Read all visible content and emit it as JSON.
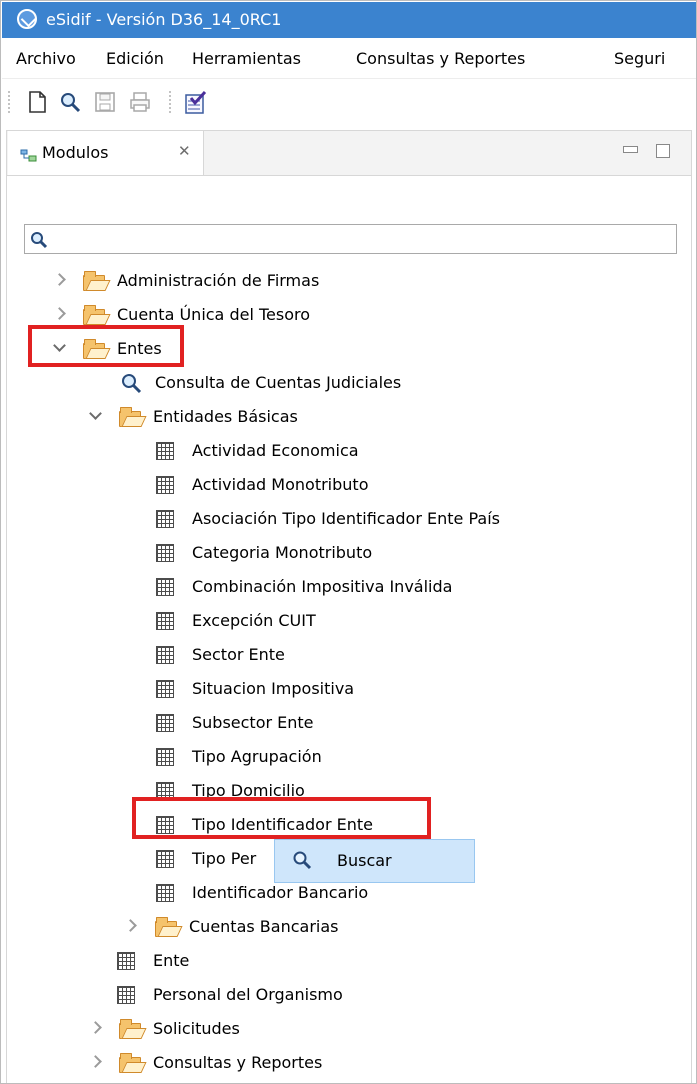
{
  "window": {
    "title": "eSidif - Versión D36_14_0RC1"
  },
  "menubar": {
    "items": [
      "Archivo",
      "Edición",
      "Herramientas",
      "Consultas y Reportes",
      "Seguri"
    ]
  },
  "toolbar": {
    "icons": [
      "new-document-icon",
      "search-icon",
      "save-icon",
      "print-icon",
      "checklist-icon"
    ]
  },
  "panel": {
    "tab_label": "Modulos",
    "close_symbol": "✕",
    "search": {
      "value": "",
      "placeholder": ""
    }
  },
  "tree": {
    "items": [
      "Administración de Firmas",
      "Cuenta Única del Tesoro",
      "Entes",
      "Consulta de Cuentas Judiciales",
      "Entidades Básicas",
      "Actividad Economica",
      "Actividad Monotributo",
      "Asociación Tipo Identificador Ente País",
      "Categoria Monotributo",
      "Combinación Impositiva Inválida",
      "Excepción CUIT",
      "Sector Ente",
      "Situacion Impositiva",
      "Subsector Ente",
      "Tipo Agrupación",
      "Tipo Domicilio",
      "Tipo Identificador Ente",
      "Tipo Per",
      "Identificador Bancario",
      "Cuentas Bancarias",
      "Ente",
      "Personal del Organismo",
      "Solicitudes",
      "Consultas y Reportes"
    ]
  },
  "context_menu": {
    "items": [
      "Buscar"
    ]
  },
  "colors": {
    "titlebar": "#3b83cf",
    "highlight": "#e12121",
    "context_menu": "#cfe6fb"
  }
}
